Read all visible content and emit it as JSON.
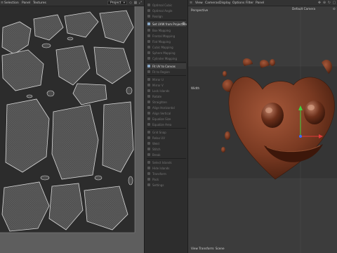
{
  "uv_editor": {
    "menu": [
      "Selection",
      "Panel",
      "Textures"
    ],
    "dropdown_value": "Project"
  },
  "command_palette": {
    "items": [
      {
        "label": "Optimal Cubic",
        "active": false
      },
      {
        "label": "Optimal Angle",
        "active": false
      },
      {
        "label": "Realign",
        "active": false
      },
      {
        "label": "Set UVW from Projection",
        "active": true,
        "gear": true
      },
      {
        "label": "Box Mapping",
        "active": false
      },
      {
        "label": "Frontal Mapping",
        "active": false
      },
      {
        "label": "Flat Mapping",
        "active": false
      },
      {
        "label": "Cubic Mapping",
        "active": false
      },
      {
        "label": "Sphere Mapping",
        "active": false
      },
      {
        "label": "Cylinder Mapping",
        "active": false
      },
      {
        "label": "Fit UV to Canvas",
        "active": true
      },
      {
        "label": "Fit to Region",
        "active": false
      },
      {
        "label": "Mirror U",
        "active": false
      },
      {
        "label": "Mirror V",
        "active": false
      },
      {
        "label": "Lock Islands",
        "active": false
      },
      {
        "label": "Rotate",
        "active": false
      },
      {
        "label": "Straighten",
        "active": false
      },
      {
        "label": "Align Horizontal",
        "active": false
      },
      {
        "label": "Align Vertical",
        "active": false
      },
      {
        "label": "Equalize Size",
        "active": false
      },
      {
        "label": "Equalize Area",
        "active": false
      },
      {
        "label": "Grid Snap",
        "active": false
      },
      {
        "label": "Relax UV",
        "active": false
      },
      {
        "label": "Weld",
        "active": false
      },
      {
        "label": "Stitch",
        "active": false
      },
      {
        "label": "Break",
        "active": false
      },
      {
        "label": "Select Islands",
        "active": false
      },
      {
        "label": "Hide Islands",
        "active": false
      },
      {
        "label": "Transform",
        "active": false
      },
      {
        "label": "Pack",
        "active": false
      },
      {
        "label": "Settings",
        "active": false
      }
    ]
  },
  "viewport": {
    "menu": [
      "View",
      "Cameras",
      "Display",
      "Options",
      "Filter",
      "Panel"
    ],
    "view_name": "Perspective",
    "camera_name": "Default Camera",
    "edge_label": "Width",
    "bottom_label": "View Transform: Scene",
    "model_color": "#7a3a22",
    "axis_y_color": "#3fd23f",
    "axis_x_color": "#e03a3a",
    "axis_z_color": "#3a6bff"
  }
}
